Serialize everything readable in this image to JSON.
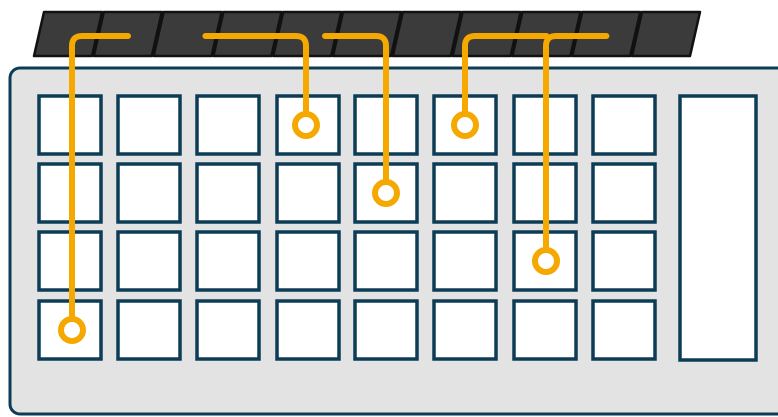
{
  "diagram": {
    "colors": {
      "background": "#ffffff",
      "panel_fill": "#e3e3e3",
      "panel_stroke": "#0d3d56",
      "cell_fill": "#ffffff",
      "cell_stroke": "#0d3d56",
      "top_key_fill": "#3b3b3b",
      "top_key_stroke": "#111111",
      "trace": "#f5a800"
    },
    "grid": {
      "rows": 4,
      "columns": 8
    },
    "top_keys": {
      "count": 11
    },
    "side_slot": {
      "present": true
    },
    "traces": [
      {
        "from_top_key": 1,
        "to_cell": {
          "row": 4,
          "column": 1
        }
      },
      {
        "from_top_key": 4,
        "to_cell": {
          "row": 1,
          "column": 4
        }
      },
      {
        "from_top_key": 6,
        "to_cell": {
          "row": 2,
          "column": 5
        }
      },
      {
        "from_top_key": 8,
        "to_cell": {
          "row": 1,
          "column": 6
        }
      },
      {
        "from_top_key": 9,
        "to_cell": {
          "row": 3,
          "column": 7
        }
      }
    ]
  }
}
